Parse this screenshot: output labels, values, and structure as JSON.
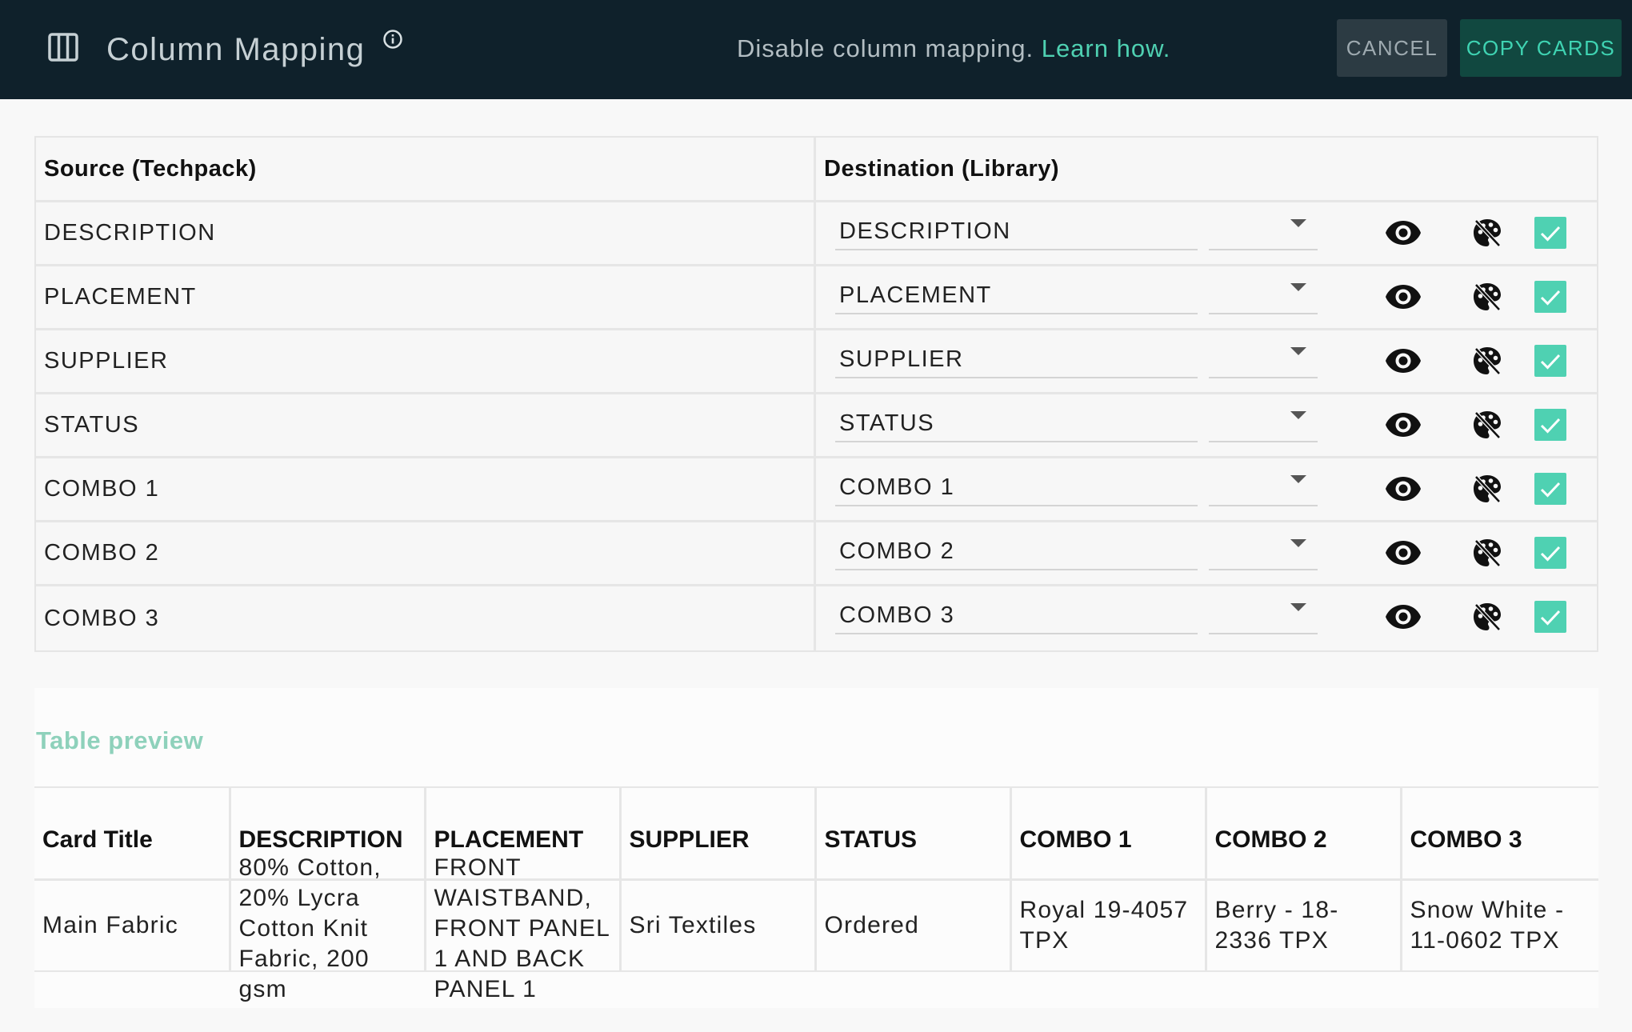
{
  "header": {
    "title": "Column Mapping",
    "notice_text": "Disable column mapping.",
    "notice_link": "Learn how.",
    "cancel_label": "CANCEL",
    "copy_label": "COPY CARDS"
  },
  "mapping": {
    "source_header": "Source (Techpack)",
    "destination_header": "Destination (Library)",
    "rows": [
      {
        "source": "DESCRIPTION",
        "destination": "DESCRIPTION",
        "visible": true,
        "mapped": true
      },
      {
        "source": "PLACEMENT",
        "destination": "PLACEMENT",
        "visible": true,
        "mapped": true
      },
      {
        "source": "SUPPLIER",
        "destination": "SUPPLIER",
        "visible": true,
        "mapped": true
      },
      {
        "source": "STATUS",
        "destination": "STATUS",
        "visible": true,
        "mapped": true
      },
      {
        "source": "COMBO 1",
        "destination": "COMBO 1",
        "visible": true,
        "mapped": true
      },
      {
        "source": "COMBO 2",
        "destination": "COMBO 2",
        "visible": true,
        "mapped": true
      },
      {
        "source": "COMBO 3",
        "destination": "COMBO 3",
        "visible": true,
        "mapped": true
      }
    ]
  },
  "preview": {
    "label": "Table preview",
    "columns": [
      "Card Title",
      "DESCRIPTION",
      "PLACEMENT",
      "SUPPLIER",
      "STATUS",
      "COMBO 1",
      "COMBO 2",
      "COMBO 3"
    ],
    "rows": [
      [
        "Main Fabric",
        "80% Cotton, 20% Lycra Cotton Knit Fabric, 200 gsm",
        "FRONT WAISTBAND, FRONT PANEL 1 AND BACK PANEL 1",
        "Sri Textiles",
        "Ordered",
        "Royal 19-4057 TPX",
        "Berry - 18-2336 TPX",
        "Snow White - 11-0602 TPX"
      ]
    ]
  },
  "colors": {
    "header_bg": "#0f212b",
    "accent": "#4fd1b2",
    "preview_label": "#8ed1bb"
  },
  "icons": {
    "header_left": "view-column-icon",
    "title_info": "info-icon",
    "row_visibility": "eye-icon",
    "row_style": "palette-off-icon",
    "row_mapped": "checkbox-checked-icon"
  }
}
